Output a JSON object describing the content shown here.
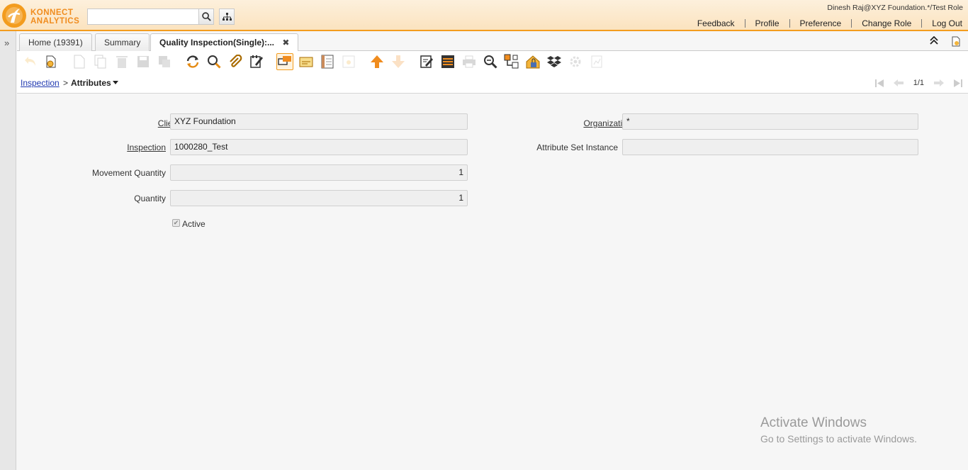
{
  "header": {
    "logo_line1": "KONNECT",
    "logo_line2": "ANALYTICS",
    "search_placeholder": "",
    "user_info": "Dinesh Raj@XYZ Foundation.*/Test Role",
    "links": [
      "Feedback",
      "Profile",
      "Preference",
      "Change Role",
      "Log Out"
    ]
  },
  "tabs": [
    {
      "label": "Home (19391)"
    },
    {
      "label": "Summary"
    },
    {
      "label": "Quality Inspection(Single):..."
    }
  ],
  "tab_close": "✖",
  "breadcrumb": {
    "parent": "Inspection",
    "separator": ">",
    "current": "Attributes"
  },
  "navigation": {
    "record_count": "1/1"
  },
  "form": {
    "client_label": "Client",
    "client_value": "XYZ Foundation",
    "organization_label": "Organization",
    "organization_value": "*",
    "inspection_label": "Inspection",
    "inspection_value": "1000280_Test",
    "attribute_set_label": "Attribute Set Instance",
    "attribute_set_value": "",
    "movement_qty_label": "Movement Quantity",
    "movement_qty_value": "1",
    "quantity_label": "Quantity",
    "quantity_value": "1",
    "active_label": "Active",
    "required_mark": "*"
  },
  "watermark": {
    "title": "Activate Windows",
    "subtitle": "Go to Settings to activate Windows."
  },
  "colors": {
    "accent": "#f39c1e",
    "link": "#1f38b0",
    "field_bg": "#efefef"
  }
}
